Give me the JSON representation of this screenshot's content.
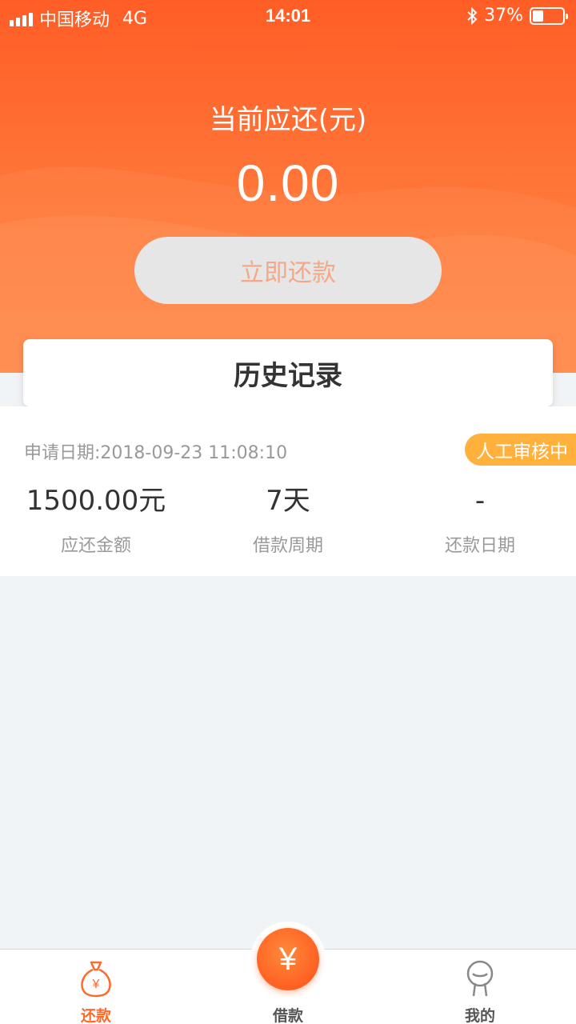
{
  "status_bar": {
    "carrier": "中国移动",
    "network": "4G",
    "time": "14:01",
    "battery_text": "37%",
    "battery_level": 0.37
  },
  "header": {
    "due_label": "当前应还(元)",
    "due_amount": "0.00",
    "repay_button_label": "立即还款"
  },
  "history": {
    "title": "历史记录"
  },
  "record": {
    "date_text": "申请日期:2018-09-23 11:08:10",
    "status": "人工审核中",
    "amount_value": "1500.00元",
    "amount_label": "应还金额",
    "period_value": "7天",
    "period_label": "借款周期",
    "repay_date_value": "-",
    "repay_date_label": "还款日期"
  },
  "bottom_nav": {
    "items": [
      {
        "label": "还款",
        "icon": "money-bag-icon",
        "active": true
      },
      {
        "label": "借款",
        "icon": "yen-icon",
        "active": false
      },
      {
        "label": "我的",
        "icon": "person-icon",
        "active": false
      }
    ],
    "center_symbol": "¥",
    "active_color": "#ff6a2b"
  },
  "colors": {
    "brand": "#ff6a2b",
    "badge": "#ffb13c"
  }
}
